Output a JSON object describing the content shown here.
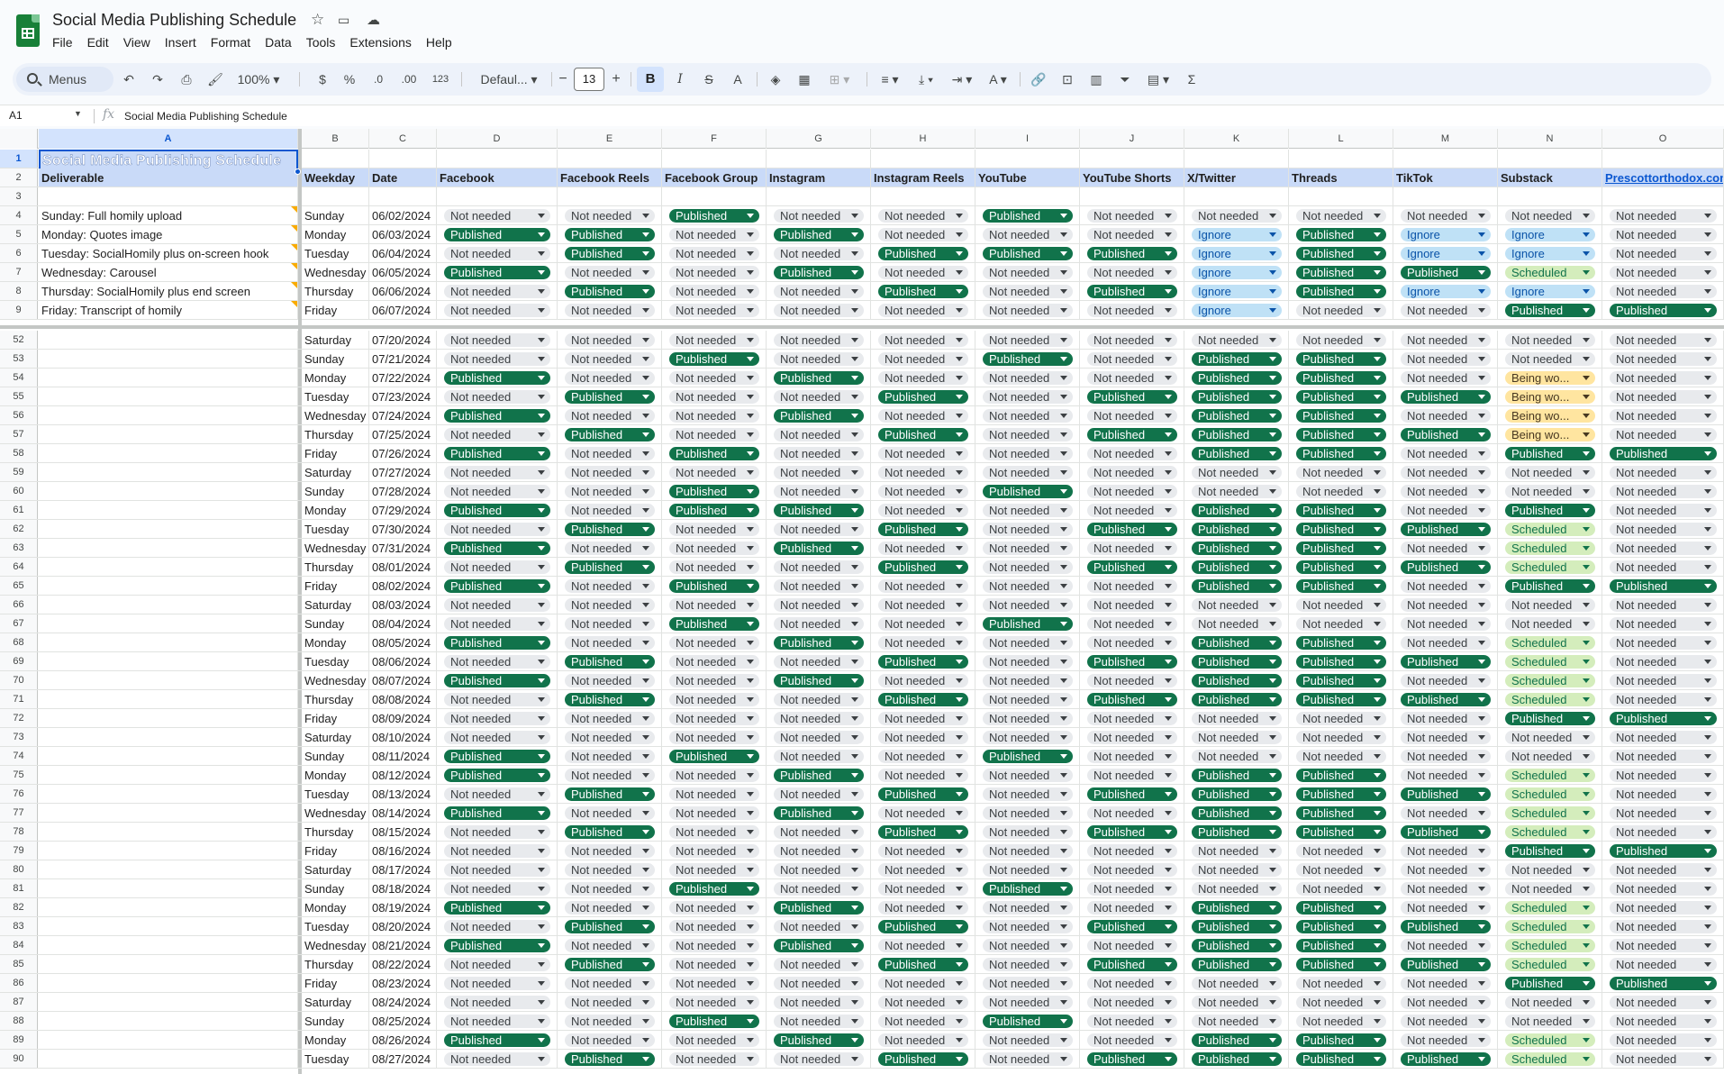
{
  "app": {
    "title": "Social Media Publishing Schedule",
    "menus": [
      "File",
      "Edit",
      "View",
      "Insert",
      "Format",
      "Data",
      "Tools",
      "Extensions",
      "Help"
    ]
  },
  "toolbar": {
    "search_label": "Menus",
    "zoom": "100%",
    "currency": "$",
    "percent": "%",
    "dec_less": ".0",
    "dec_more": ".00",
    "number_format": "123",
    "font": "Defaul...",
    "font_size": "13",
    "bold": "B",
    "italic": "I",
    "strike": "S",
    "text_color": "A",
    "sum": "Σ"
  },
  "formula_bar": {
    "cell_ref": "A1",
    "fx": "fx",
    "content": "Social Media Publishing Schedule"
  },
  "columns": [
    "A",
    "B",
    "C",
    "D",
    "E",
    "F",
    "G",
    "H",
    "I",
    "J",
    "K",
    "L",
    "M",
    "N",
    "O"
  ],
  "header_row": [
    "Deliverable",
    "Weekday",
    "Date",
    "Facebook",
    "Facebook Reels",
    "Facebook Group",
    "Instagram",
    "Instagram Reels",
    "YouTube",
    "YouTube Shorts",
    "X/Twitter",
    "Threads",
    "TikTok",
    "Substack",
    "Prescottorthodox.com"
  ],
  "sheet_title": "Social Media Publishing Schedule",
  "status_legend": {
    "N": "Not needed",
    "P": "Published",
    "I": "Ignore",
    "S": "Scheduled",
    "W": "Being wo..."
  },
  "top_rows": [
    {
      "num": "4",
      "deliverable": "Sunday: Full homily upload",
      "weekday": "Sunday",
      "date": "06/02/2024",
      "s": "NNPNNPNNNNN",
      "ws": ""
    },
    {
      "num": "5",
      "deliverable": "Monday: Quotes image",
      "weekday": "Monday",
      "date": "06/03/2024",
      "s": "PPNPNNNIPII",
      "ws": "N"
    },
    {
      "num": "6",
      "deliverable": "Tuesday: SocialHomily plus on-screen hook",
      "weekday": "Tuesday",
      "date": "06/04/2024",
      "s": "NPNNPPPIPII",
      "ws": "N"
    },
    {
      "num": "7",
      "deliverable": "Wednesday: Carousel",
      "weekday": "Wednesday",
      "date": "06/05/2024",
      "s": "PNNPNNNIPPS",
      "ws": "N"
    },
    {
      "num": "8",
      "deliverable": "Thursday: SocialHomily plus end screen",
      "weekday": "Thursday",
      "date": "06/06/2024",
      "s": "NPNNPNPIPII",
      "ws": "N"
    },
    {
      "num": "9",
      "deliverable": "Friday: Transcript of homily",
      "weekday": "Friday",
      "date": "06/07/2024",
      "s": "NNNNNNNINNP",
      "ws": "P"
    }
  ],
  "rows": [
    {
      "num": "52",
      "weekday": "Saturday",
      "date": "07/20/2024",
      "s": "NNNNNNNNNNNN"
    },
    {
      "num": "53",
      "weekday": "Sunday",
      "date": "07/21/2024",
      "s": "NNPNNPNPPNNN"
    },
    {
      "num": "54",
      "weekday": "Monday",
      "date": "07/22/2024",
      "s": "PNNPNNNPPNWN"
    },
    {
      "num": "55",
      "weekday": "Tuesday",
      "date": "07/23/2024",
      "s": "NPNNPNPPPPWN"
    },
    {
      "num": "56",
      "weekday": "Wednesday",
      "date": "07/24/2024",
      "s": "PNNPNNNPPNWN"
    },
    {
      "num": "57",
      "weekday": "Thursday",
      "date": "07/25/2024",
      "s": "NPNNPNPPPPWN"
    },
    {
      "num": "58",
      "weekday": "Friday",
      "date": "07/26/2024",
      "s": "PNPNNNNPPNPP"
    },
    {
      "num": "59",
      "weekday": "Saturday",
      "date": "07/27/2024",
      "s": "NNNNNNNNNNNN"
    },
    {
      "num": "60",
      "weekday": "Sunday",
      "date": "07/28/2024",
      "s": "NNPNNPNNNNNN"
    },
    {
      "num": "61",
      "weekday": "Monday",
      "date": "07/29/2024",
      "s": "PNPPNNNPPNPN"
    },
    {
      "num": "62",
      "weekday": "Tuesday",
      "date": "07/30/2024",
      "s": "NPNNPNPPPPSN"
    },
    {
      "num": "63",
      "weekday": "Wednesday",
      "date": "07/31/2024",
      "s": "PNNPNNNPPNSN"
    },
    {
      "num": "64",
      "weekday": "Thursday",
      "date": "08/01/2024",
      "s": "NPNNPNPPPPSN"
    },
    {
      "num": "65",
      "weekday": "Friday",
      "date": "08/02/2024",
      "s": "PNPNNNNPPNPP"
    },
    {
      "num": "66",
      "weekday": "Saturday",
      "date": "08/03/2024",
      "s": "NNNNNNNNNNNN"
    },
    {
      "num": "67",
      "weekday": "Sunday",
      "date": "08/04/2024",
      "s": "NNPNNPNNNNNN"
    },
    {
      "num": "68",
      "weekday": "Monday",
      "date": "08/05/2024",
      "s": "PNNPNNNPPNSN"
    },
    {
      "num": "69",
      "weekday": "Tuesday",
      "date": "08/06/2024",
      "s": "NPNNPNPPPPSN"
    },
    {
      "num": "70",
      "weekday": "Wednesday",
      "date": "08/07/2024",
      "s": "PNNPNNNPPNSN"
    },
    {
      "num": "71",
      "weekday": "Thursday",
      "date": "08/08/2024",
      "s": "NPNNPNPPPPSN"
    },
    {
      "num": "72",
      "weekday": "Friday",
      "date": "08/09/2024",
      "s": "NNNNNNNNNNPP"
    },
    {
      "num": "73",
      "weekday": "Saturday",
      "date": "08/10/2024",
      "s": "NNNNNNNNNNNN"
    },
    {
      "num": "74",
      "weekday": "Sunday",
      "date": "08/11/2024",
      "s": "PNPNNPNNNNNN"
    },
    {
      "num": "75",
      "weekday": "Monday",
      "date": "08/12/2024",
      "s": "PNNPNNNPPNSN"
    },
    {
      "num": "76",
      "weekday": "Tuesday",
      "date": "08/13/2024",
      "s": "NPNNPNPPPPSN"
    },
    {
      "num": "77",
      "weekday": "Wednesday",
      "date": "08/14/2024",
      "s": "PNNPNNNPPNSN"
    },
    {
      "num": "78",
      "weekday": "Thursday",
      "date": "08/15/2024",
      "s": "NPNNPNPPPPSN"
    },
    {
      "num": "79",
      "weekday": "Friday",
      "date": "08/16/2024",
      "s": "NNNNNNNNNNPP"
    },
    {
      "num": "80",
      "weekday": "Saturday",
      "date": "08/17/2024",
      "s": "NNNNNNNNNNNN"
    },
    {
      "num": "81",
      "weekday": "Sunday",
      "date": "08/18/2024",
      "s": "NNPNNPNNNNNN"
    },
    {
      "num": "82",
      "weekday": "Monday",
      "date": "08/19/2024",
      "s": "PNNPNNNPPNSN"
    },
    {
      "num": "83",
      "weekday": "Tuesday",
      "date": "08/20/2024",
      "s": "NPNNPNPPPPSN"
    },
    {
      "num": "84",
      "weekday": "Wednesday",
      "date": "08/21/2024",
      "s": "PNNPNNNPPNSN"
    },
    {
      "num": "85",
      "weekday": "Thursday",
      "date": "08/22/2024",
      "s": "NPNNPNPPPPSN"
    },
    {
      "num": "86",
      "weekday": "Friday",
      "date": "08/23/2024",
      "s": "NNNNNNNNNNPP"
    },
    {
      "num": "87",
      "weekday": "Saturday",
      "date": "08/24/2024",
      "s": "NNNNNNNNNNNN"
    },
    {
      "num": "88",
      "weekday": "Sunday",
      "date": "08/25/2024",
      "s": "NNPNNPNNNNNN"
    },
    {
      "num": "89",
      "weekday": "Monday",
      "date": "08/26/2024",
      "s": "PNNPNNNPPNSN"
    },
    {
      "num": "90",
      "weekday": "Tuesday",
      "date": "08/27/2024",
      "s": "NPNNPNPPPPSN"
    }
  ]
}
